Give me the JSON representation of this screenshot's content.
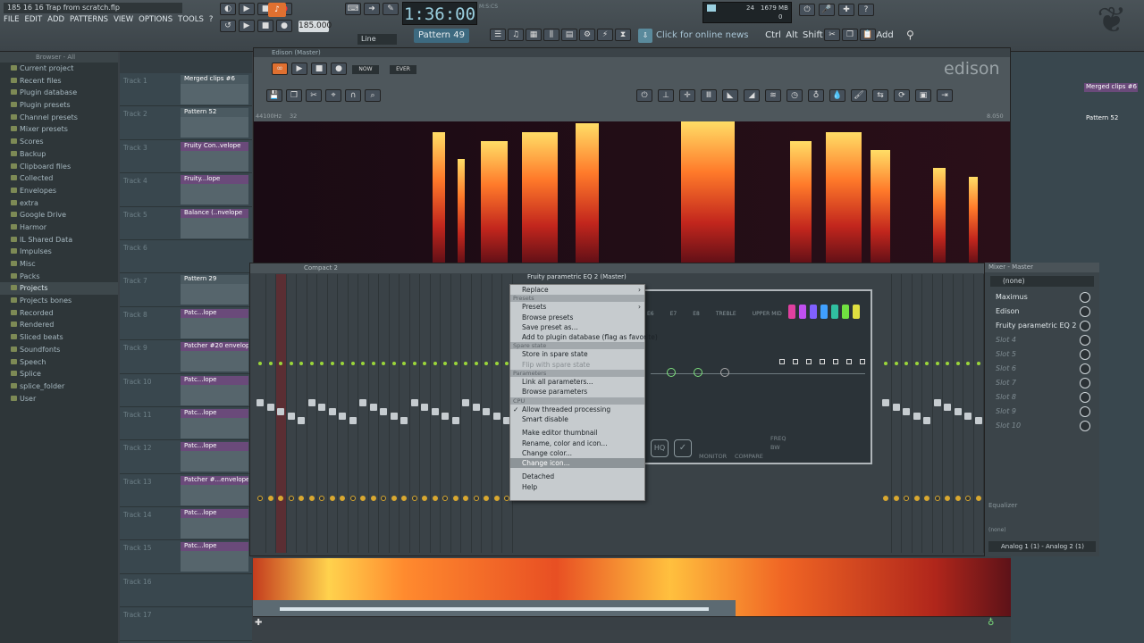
{
  "topbar": {
    "title": "185 16 16 Trap from scratch.flp",
    "menus": [
      "FILE",
      "EDIT",
      "ADD",
      "PATTERNS",
      "VIEW",
      "OPTIONS",
      "TOOLS",
      "?"
    ],
    "tempo": "185.000",
    "time": "1:36:00",
    "time_unit": "M:S:CS",
    "pattern": "Pattern 49",
    "snap": "Line",
    "news": "Click for online news",
    "cpu": "24",
    "memory": "1679 MB",
    "voices": "0",
    "keys": [
      "Ctrl",
      "Alt",
      "Shift"
    ],
    "add_label": "Add"
  },
  "browser": {
    "header": "Browser - All",
    "items": [
      "Current project",
      "Recent files",
      "Plugin database",
      "Plugin presets",
      "Channel presets",
      "Mixer presets",
      "Scores",
      "Backup",
      "Clipboard files",
      "Collected",
      "Envelopes",
      "extra",
      "Google Drive",
      "Harmor",
      "IL Shared Data",
      "Impulses",
      "Misc",
      "Packs",
      "Projects",
      "Projects bones",
      "Recorded",
      "Rendered",
      "Sliced beats",
      "Soundfonts",
      "Speech",
      "Splice",
      "splice_folder",
      "User"
    ]
  },
  "playlist": {
    "tracks": [
      {
        "name": "Track 1",
        "clip": "Merged clips #6"
      },
      {
        "name": "Track 2",
        "clip": "Pattern 52"
      },
      {
        "name": "Track 3",
        "clip": "Fruity Con..velope"
      },
      {
        "name": "Track 4",
        "clip": "Fruity...lope"
      },
      {
        "name": "Track 5",
        "clip": "Balance (..nvelope"
      },
      {
        "name": "Track 6",
        "clip": ""
      },
      {
        "name": "Track 7",
        "clip": "Pattern 29"
      },
      {
        "name": "Track 8",
        "clip": "Patc...lope"
      },
      {
        "name": "Track 9",
        "clip": "Patcher #20 envelop"
      },
      {
        "name": "Track 10",
        "clip": "Patc...lope"
      },
      {
        "name": "Track 11",
        "clip": "Patc...lope"
      },
      {
        "name": "Track 12",
        "clip": "Patc...lope"
      },
      {
        "name": "Track 13",
        "clip": "Patcher #...envelope"
      },
      {
        "name": "Track 14",
        "clip": "Patc...lope"
      },
      {
        "name": "Track 15",
        "clip": "Patc...lope"
      },
      {
        "name": "Track 16",
        "clip": ""
      },
      {
        "name": "Track 17",
        "clip": ""
      }
    ]
  },
  "edison": {
    "title": "Edison (Master)",
    "logo": "edison",
    "sample_rate": "44100Hz",
    "bits": "32",
    "position": "8.050",
    "buttons": [
      "NOW",
      "EVER"
    ]
  },
  "mixer": {
    "title": "Compact 2",
    "eq_title": "Fruity parametric EQ 2 (Master)",
    "eq_labels": [
      "MONITOR",
      "COMPARE",
      "FREQ",
      "BW"
    ],
    "eq_band_labels": [
      "E6",
      "E7",
      "E8",
      "TREBLE",
      "UPPER MID"
    ],
    "master_title": "Mixer - Master",
    "preset": "(none)",
    "slots": [
      "Maximus",
      "Edison",
      "Fruity parametric EQ 2",
      "Slot 4",
      "Slot 5",
      "Slot 6",
      "Slot 7",
      "Slot 8",
      "Slot 9",
      "Slot 10"
    ],
    "equalizer": "Equalizer",
    "output": "Analog 1 (1) - Analog 2 (1)",
    "none_label": "(none)"
  },
  "context_menu": {
    "items": [
      {
        "label": "Replace",
        "type": "item",
        "arrow": true
      },
      {
        "label": "Presets",
        "type": "section"
      },
      {
        "label": "Presets",
        "type": "item",
        "arrow": true
      },
      {
        "label": "Browse presets",
        "type": "item"
      },
      {
        "label": "Save preset as...",
        "type": "item"
      },
      {
        "label": "Add to plugin database (flag as favorite)",
        "type": "item"
      },
      {
        "label": "Spare state",
        "type": "section"
      },
      {
        "label": "Store in spare state",
        "type": "item"
      },
      {
        "label": "Flip with spare state",
        "type": "disabled"
      },
      {
        "label": "Parameters",
        "type": "section"
      },
      {
        "label": "Link all parameters...",
        "type": "item"
      },
      {
        "label": "Browse parameters",
        "type": "item"
      },
      {
        "label": "CPU",
        "type": "section"
      },
      {
        "label": "Allow threaded processing",
        "type": "item",
        "check": true
      },
      {
        "label": "Smart disable",
        "type": "item"
      },
      {
        "label": "",
        "type": "sep"
      },
      {
        "label": "Make editor thumbnail",
        "type": "item"
      },
      {
        "label": "Rename, color and icon...",
        "type": "item"
      },
      {
        "label": "Change color...",
        "type": "item"
      },
      {
        "label": "Change icon...",
        "type": "highlight"
      },
      {
        "label": "",
        "type": "sep"
      },
      {
        "label": "Detached",
        "type": "item"
      },
      {
        "label": "Help",
        "type": "item"
      }
    ]
  },
  "colors": {
    "accent": "#3d6a80",
    "clip_purple": "#6a4a7a",
    "eq_bands": [
      "#e040a0",
      "#c050f0",
      "#8060ff",
      "#40a0ff",
      "#30c0a0",
      "#70e040",
      "#e0e040"
    ]
  }
}
